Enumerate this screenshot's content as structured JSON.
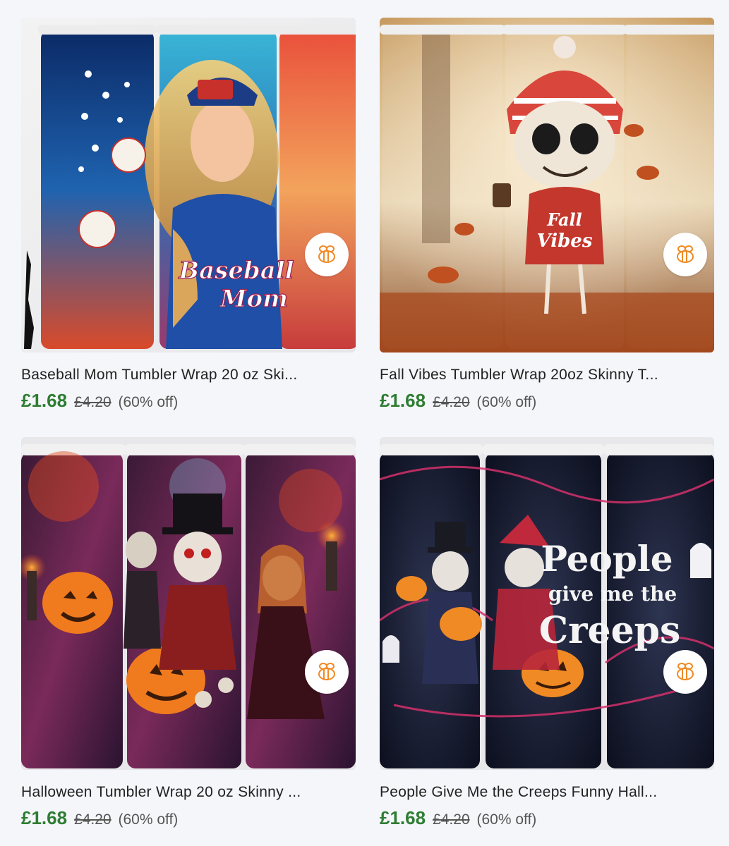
{
  "listings": [
    {
      "title": "Baseball Mom Tumbler Wrap 20 oz Ski...",
      "price": "£1.68",
      "original_price": "£4.20",
      "discount": "(60% off)",
      "image_text": [
        "Baseball",
        "Mom"
      ],
      "badge_icon": "bee-icon"
    },
    {
      "title": "Fall Vibes Tumbler Wrap 20oz Skinny T...",
      "price": "£1.68",
      "original_price": "£4.20",
      "discount": "(60% off)",
      "image_text": [
        "Fall",
        "Vibes"
      ],
      "badge_icon": "bee-icon"
    },
    {
      "title": "Halloween Tumbler Wrap 20 oz Skinny ...",
      "price": "£1.68",
      "original_price": "£4.20",
      "discount": "(60% off)",
      "badge_icon": "bee-icon"
    },
    {
      "title": "People Give Me the Creeps Funny Hall...",
      "price": "£1.68",
      "original_price": "£4.20",
      "discount": "(60% off)",
      "image_text": [
        "People",
        "give me the",
        "Creeps"
      ],
      "badge_icon": "bee-icon"
    }
  ],
  "colors": {
    "price_green": "#2e7d32",
    "badge_orange": "#f08a24",
    "background": "#f5f6fa"
  }
}
